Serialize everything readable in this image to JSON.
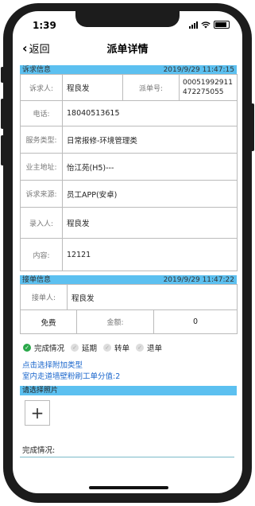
{
  "status_bar": {
    "time": "1:39"
  },
  "nav": {
    "back_label": "返回",
    "title": "派单详情"
  },
  "appeal_section": {
    "header_label": "诉求信息",
    "header_time": "2019/9/29 11:47:15",
    "appellant_label": "诉求人:",
    "appellant_value": "程良发",
    "order_no_label": "派单号:",
    "order_no_value": "00051992911472275055",
    "rows": [
      {
        "label": "电话:",
        "value": "18040513615"
      },
      {
        "label": "服务类型:",
        "value": "日常报修-环境管理类"
      },
      {
        "label": "业主地址:",
        "value": "怡江苑(H5)---"
      },
      {
        "label": "诉求来源:",
        "value": "员工APP(安卓)"
      },
      {
        "label": "录入人:",
        "value": "程良发"
      },
      {
        "label": "内容:",
        "value": "12121"
      }
    ]
  },
  "receive_section": {
    "header_label": "接单信息",
    "header_time": "2019/9/29 11:47:22",
    "receiver_label": "接单人:",
    "receiver_value": "程良发",
    "fee_type": "免费",
    "amount_label": "金额:",
    "amount_value": "0"
  },
  "status_options": [
    {
      "label": "完成情况",
      "selected": true
    },
    {
      "label": "延期",
      "selected": false
    },
    {
      "label": "转单",
      "selected": false
    },
    {
      "label": "退单",
      "selected": false
    }
  ],
  "extra_type_link": "点击选择附加类型",
  "extra_type_note": "室内走道墙壁粉刷工单分值:2",
  "photo_header": "请选择照片",
  "completion_label": "完成情况:",
  "colors": {
    "section_header": "#5cc0f0",
    "link": "#1a66cc",
    "check": "#2aa84a"
  }
}
